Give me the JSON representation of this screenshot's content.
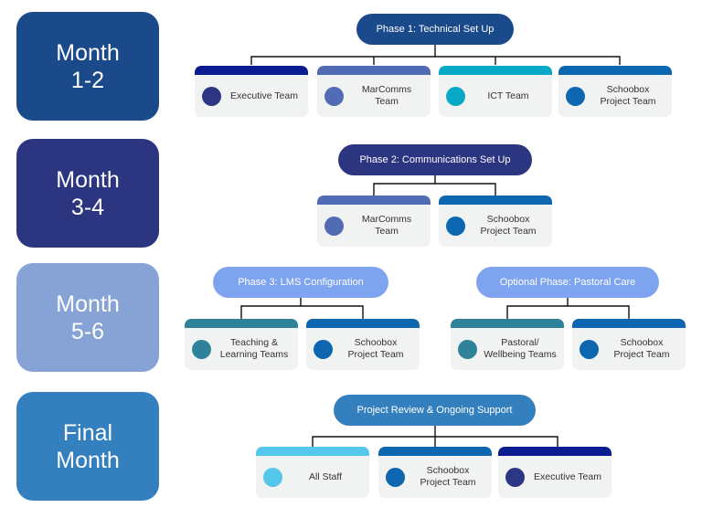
{
  "colors": {
    "month_1_2": "#1a4a8a",
    "month_3_4": "#2b3580",
    "month_5_6": "#87a3d6",
    "month_final": "#3480bf",
    "phase_1": "#1a4a8a",
    "phase_2": "#2b3580",
    "phase_3": "#7ea4ef",
    "phase_final": "#3480bf",
    "executive": "#2d3585",
    "executive_bar": "#0b1b90",
    "marcomms": "#526bb5",
    "ict": "#08a9c6",
    "schoobox": "#0c67b0",
    "teaching": "#2e8299",
    "all_staff": "#55c6ec",
    "card_bg": "#f1f2f2"
  },
  "rows": [
    {
      "month": "Month\n1-2",
      "phases": [
        {
          "label": "Phase 1: Technical Set Up",
          "teams": [
            "Executive Team",
            "MarComms\nTeam",
            "ICT Team",
            "Schoobox\nProject Team"
          ]
        }
      ]
    },
    {
      "month": "Month\n3-4",
      "phases": [
        {
          "label": "Phase 2: Communications Set Up",
          "teams": [
            "MarComms\nTeam",
            "Schoobox\nProject Team"
          ]
        }
      ]
    },
    {
      "month": "Month\n5-6",
      "phases": [
        {
          "label": "Phase 3: LMS Configuration",
          "teams": [
            "Teaching &\nLearning Teams",
            "Schoobox\nProject Team"
          ]
        },
        {
          "label": "Optional Phase: Pastoral Care",
          "teams": [
            "Pastoral/\nWellbeing Teams",
            "Schoobox\nProject Team"
          ]
        }
      ]
    },
    {
      "month": "Final\nMonth",
      "phases": [
        {
          "label": "Project Review & Ongoing Support",
          "teams": [
            "All Staff",
            "Schoobox\nProject Team",
            "Executive Team"
          ]
        }
      ]
    }
  ]
}
